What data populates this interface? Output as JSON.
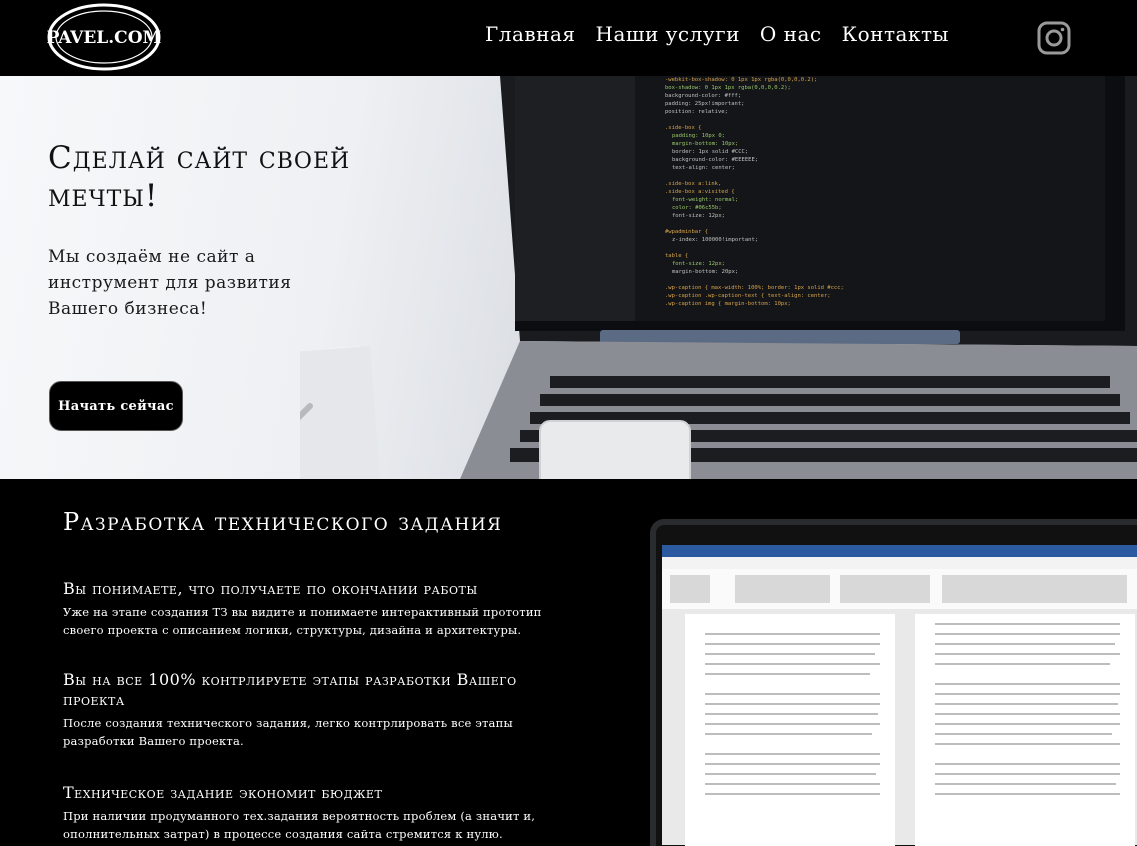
{
  "header": {
    "logo_text": "PAVEL.COM",
    "nav": [
      {
        "label": "Главная"
      },
      {
        "label": "Наши услуги"
      },
      {
        "label": "О нас"
      },
      {
        "label": "Контакты"
      }
    ],
    "social_icon": "instagram-icon"
  },
  "hero": {
    "title": "Сделай сайт своей мечты!",
    "subtitle": "Мы создаём не сайт а инструмент для развития Вашего бизнеса!",
    "cta_label": "Начать сейчас"
  },
  "section": {
    "title": "Разработка технического задания",
    "features": [
      {
        "heading": "Вы понимаете, что получаете по окончании работы",
        "text": "Уже на этапе создания ТЗ вы видите и понимаете интерактивный прототип своего проекта с описанием логики, структуры, дизайна и архитектуры."
      },
      {
        "heading": "Вы на все 100% контрлируете этапы разработки Вашего проекта",
        "text": "После создания технического задания, легко контрлировать все этапы разработки Вашего проекта."
      },
      {
        "heading": "Техническое задание экономит бюджет",
        "text": "При наличии продуманного тех.задания вероятность проблем (а значит и, ополнительных затрат) в процессе создания сайта стремится к нулю."
      }
    ]
  },
  "colors": {
    "background": "#000000",
    "text": "#ffffff",
    "hero_text": "#111111"
  }
}
